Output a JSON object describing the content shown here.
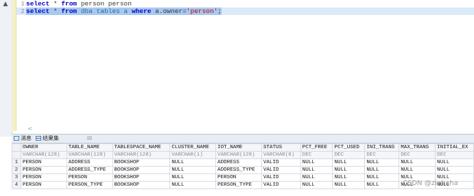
{
  "editor": {
    "lines": [
      {
        "num": "1",
        "kw1": "select",
        "star": " * ",
        "kw2": "from",
        "rest": " person person"
      },
      {
        "num": "2",
        "kw1": "select",
        "star": " * ",
        "kw2": "from",
        "tbl": " dba tables a ",
        "kw3": "where",
        "cond": " a.owner=",
        "str": "'person'",
        "end": ";"
      }
    ],
    "scroll_hint": "<"
  },
  "results": {
    "tabs": [
      {
        "label": "消息"
      },
      {
        "label": "结果集"
      }
    ],
    "close_glyph": "☒",
    "columns": [
      {
        "name": "OWNER",
        "type": "VARCHAR(128)"
      },
      {
        "name": "TABLE_NAME",
        "type": "VARCHAR(128)"
      },
      {
        "name": "TABLESPACE_NAME",
        "type": "VARCHAR(128)"
      },
      {
        "name": "CLUSTER_NAME",
        "type": "VARCHAR(1)"
      },
      {
        "name": "IOT_NAME",
        "type": "VARCHAR(128)"
      },
      {
        "name": "STATUS",
        "type": "VARCHAR(8)"
      },
      {
        "name": "PCT_FREE",
        "type": "DEC"
      },
      {
        "name": "PCT_USED",
        "type": "DEC"
      },
      {
        "name": "INI_TRANS",
        "type": "DEC"
      },
      {
        "name": "MAX_TRANS",
        "type": "DEC"
      },
      {
        "name": "INITIAL_EX",
        "type": "DEC"
      }
    ],
    "rows": [
      {
        "n": "1",
        "cells": [
          "PERSON",
          "ADDRESS",
          "BOOKSHOP",
          "NULL",
          "ADDRESS",
          "VALID",
          "NULL",
          "NULL",
          "NULL",
          "NULL",
          "NULL"
        ]
      },
      {
        "n": "2",
        "cells": [
          "PERSON",
          "ADDRESS_TYPE",
          "BOOKSHOP",
          "NULL",
          "ADDRESS_TYPE",
          "VALID",
          "NULL",
          "NULL",
          "NULL",
          "NULL",
          "NULL"
        ]
      },
      {
        "n": "3",
        "cells": [
          "PERSON",
          "PERSON",
          "BOOKSHOP",
          "NULL",
          "PERSON",
          "VALID",
          "NULL",
          "NULL",
          "NULL",
          "NULL",
          "NULL"
        ]
      },
      {
        "n": "4",
        "cells": [
          "PERSON",
          "PERSON_TYPE",
          "BOOKSHOP",
          "NULL",
          "PERSON_TYPE",
          "VALID",
          "NULL",
          "NULL",
          "NULL",
          "NULL",
          "NULL"
        ]
      }
    ]
  },
  "watermark": "CSDN @ziahaha"
}
